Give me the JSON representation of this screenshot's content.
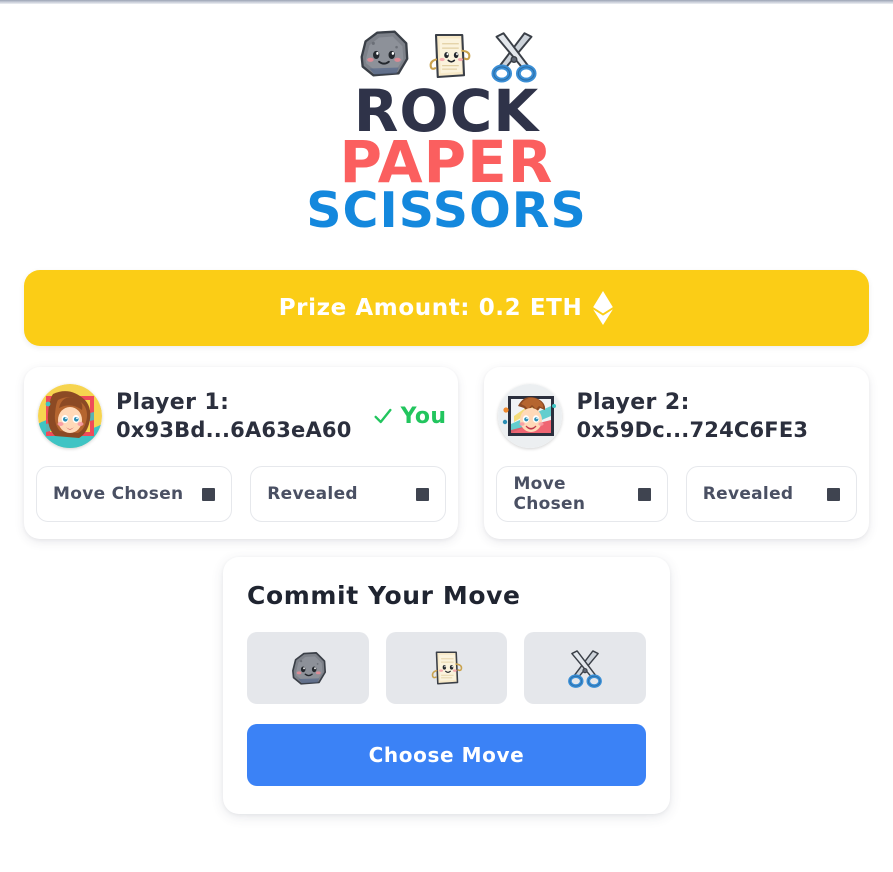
{
  "header": {
    "title_line1": "ROCK",
    "title_line2": "PAPER",
    "title_line3": "SCISSORS",
    "emoji_rock": "rock-emoji",
    "emoji_paper": "paper-emoji",
    "emoji_scissors": "scissors-emoji",
    "colors": {
      "rock": "#2f3349",
      "paper": "#fb5f5f",
      "scissors": "#1488dd"
    }
  },
  "prize": {
    "label": "Prize Amount: 0.2 ETH",
    "amount": "0.2",
    "currency": "ETH",
    "icon": "ethereum-diamond-icon",
    "background": "#fbcd16",
    "text_color": "#ffffff"
  },
  "players": [
    {
      "label": "Player 1:",
      "address": "0x93Bd...6A63eA60",
      "avatar": "girl-pixel-avatar",
      "is_you": true,
      "you_label": "You",
      "you_color": "#22c55e",
      "check_icon": "check-icon",
      "status": [
        {
          "label": "Move Chosen",
          "indicator": "dark-square-glyph",
          "value": false
        },
        {
          "label": "Revealed",
          "indicator": "dark-square-glyph",
          "value": false
        }
      ]
    },
    {
      "label": "Player 2:",
      "address": "0x59Dc...724C6FE3",
      "avatar": "boy-pixel-avatar",
      "is_you": false,
      "you_label": "",
      "status": [
        {
          "label": "Move Chosen",
          "indicator": "dark-square-glyph",
          "value": false
        },
        {
          "label": "Revealed",
          "indicator": "dark-square-glyph",
          "value": false
        }
      ]
    }
  ],
  "commit": {
    "title": "Commit Your Move",
    "moves": [
      {
        "name": "rock",
        "icon": "rock-emoji",
        "selected": false
      },
      {
        "name": "paper",
        "icon": "paper-emoji",
        "selected": false
      },
      {
        "name": "scissors",
        "icon": "scissors-emoji",
        "selected": false
      }
    ],
    "button_label": "Choose Move",
    "button_color": "#3b82f6"
  }
}
